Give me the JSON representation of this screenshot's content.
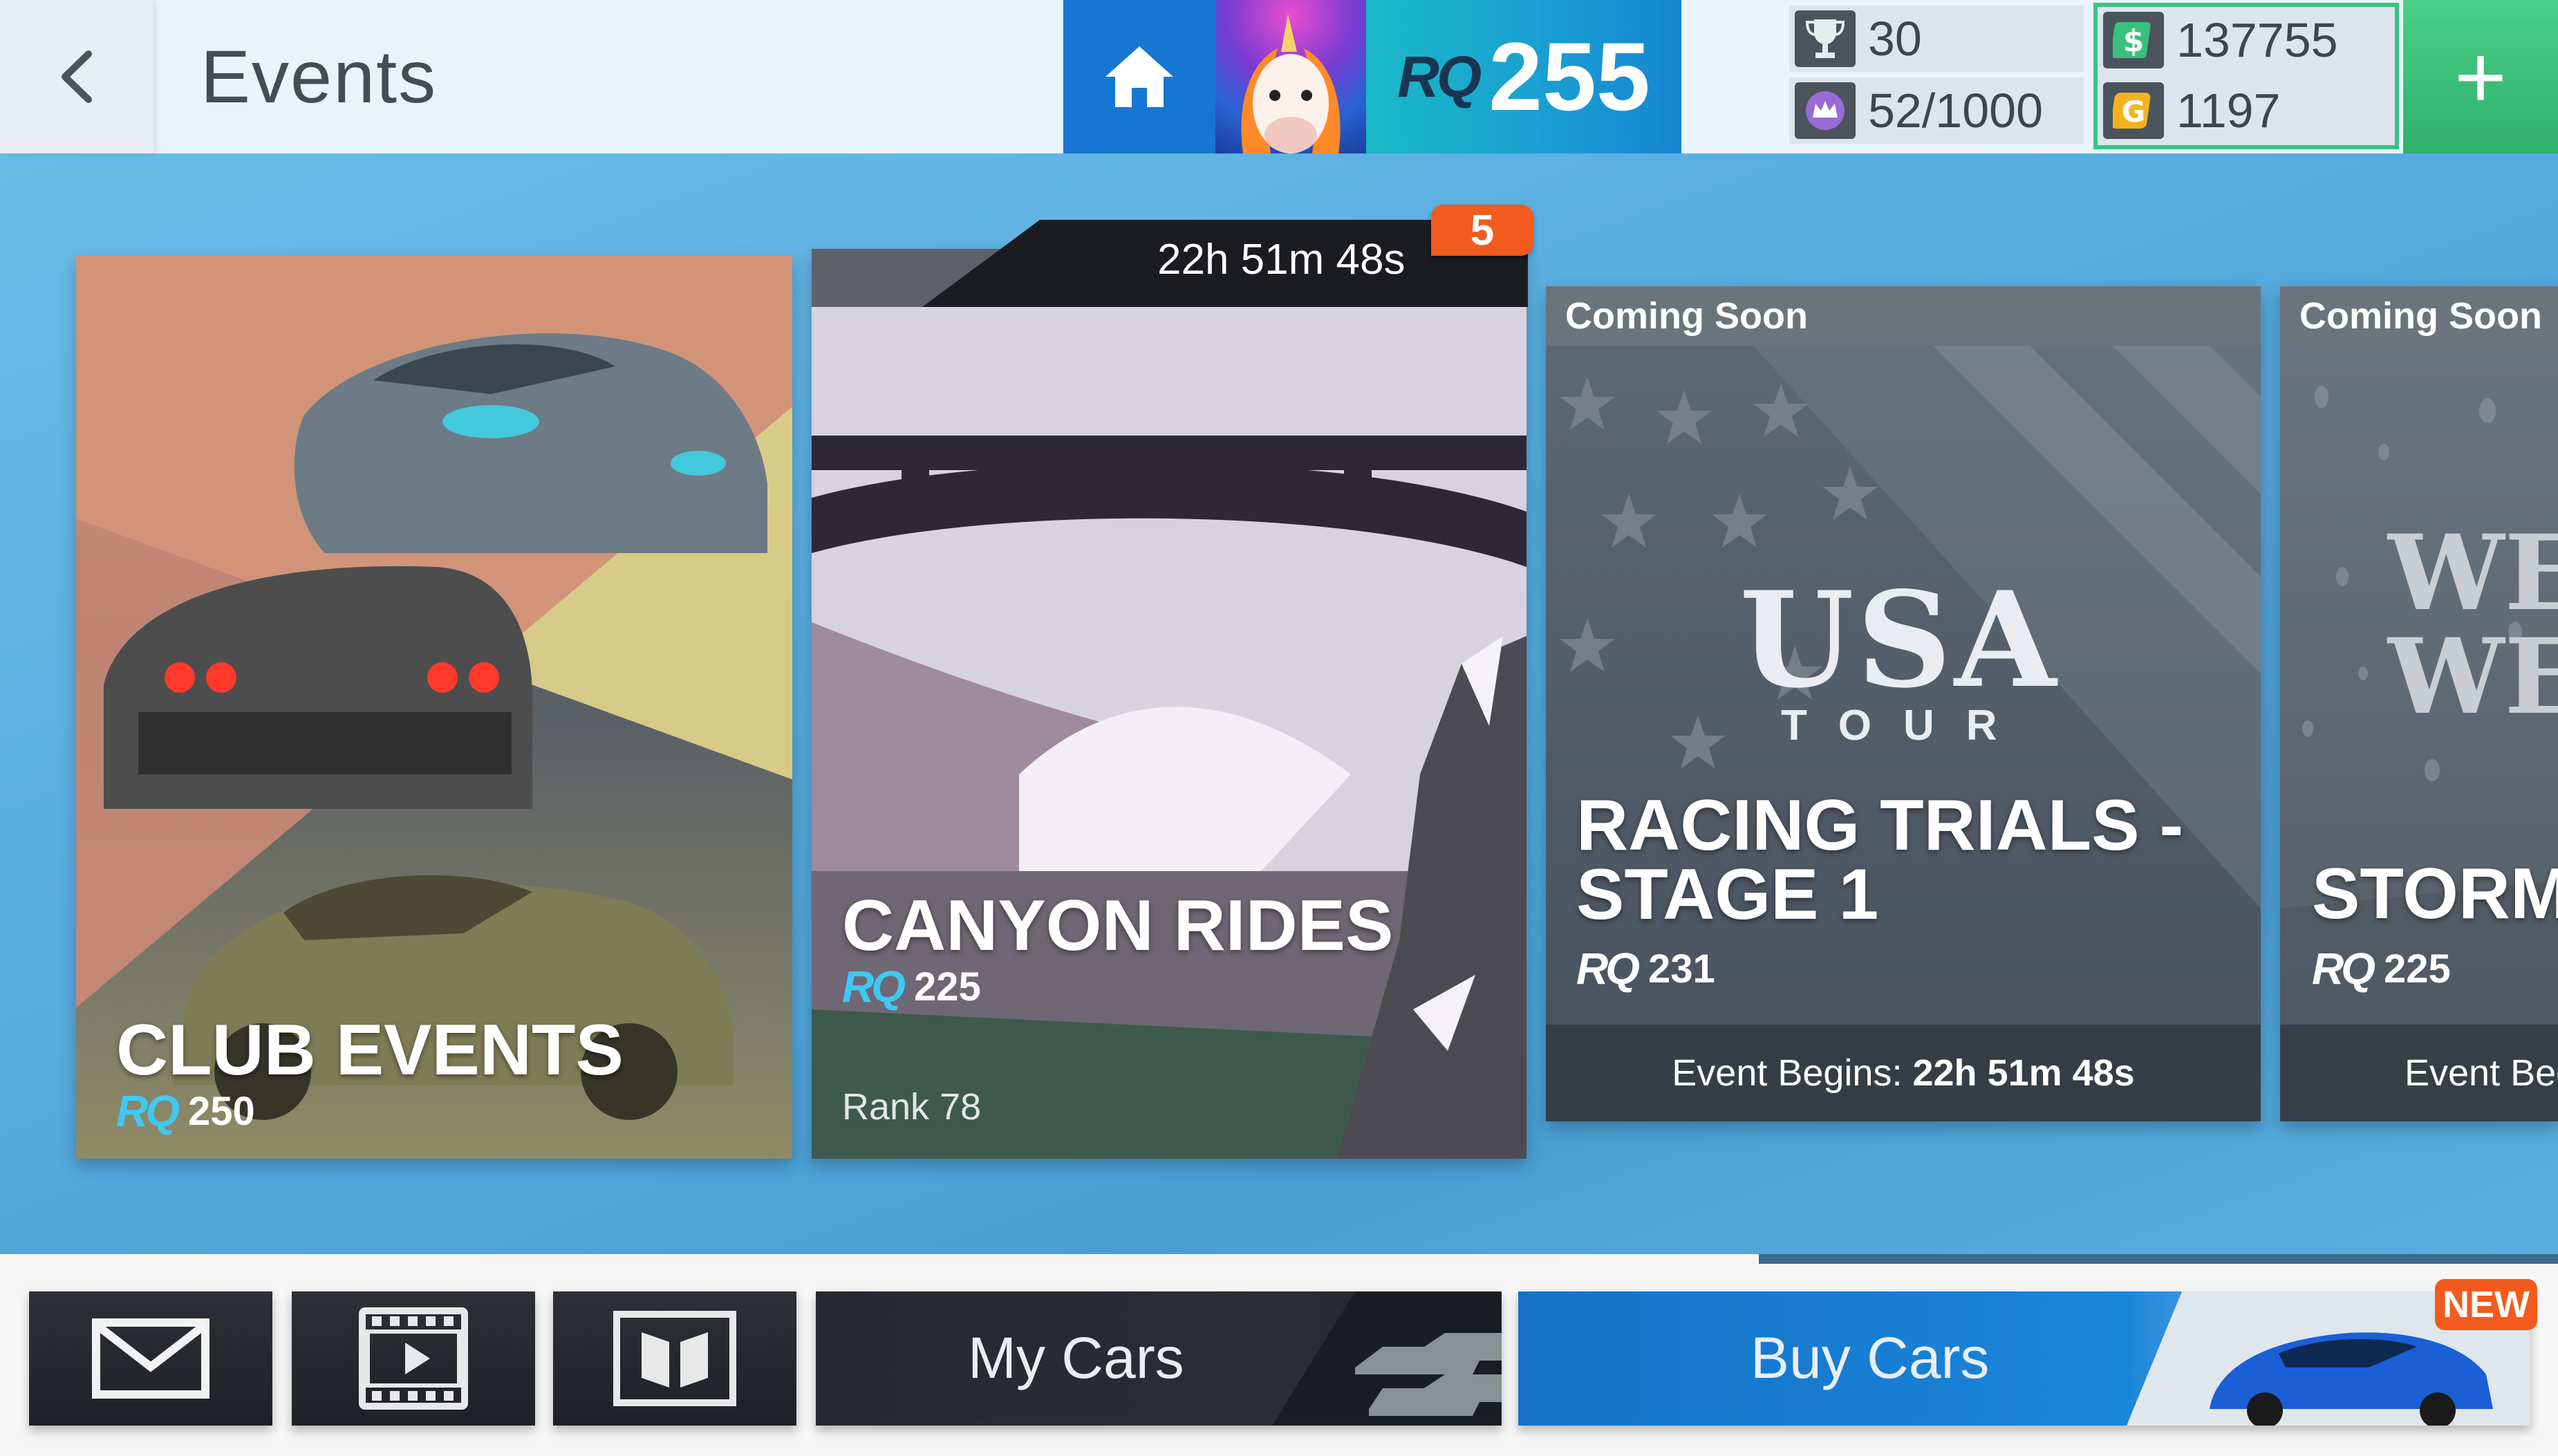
{
  "header": {
    "title": "Events",
    "rq_logo": "RQ",
    "rq_value": "255",
    "trophies": "30",
    "crowns": "52/1000",
    "cash": "137755",
    "gold": "1197",
    "plus": "+"
  },
  "cards": [
    {
      "title": "CLUB EVENTS",
      "rq_logo": "RQ",
      "rq": "250"
    },
    {
      "title": "CANYON RIDES",
      "rq_logo": "RQ",
      "rq": "225",
      "rank": "Rank 78",
      "timer": "22h 51m 48s",
      "badge": "5"
    },
    {
      "status": "Coming Soon",
      "art_line1": "USA",
      "art_line2": "TOUR",
      "title_line1": "RACING TRIALS -",
      "title_line2": "STAGE 1",
      "rq_logo": "RQ",
      "rq": "231",
      "footer_label": "Event Begins:",
      "footer_time": "22h 51m 48s"
    },
    {
      "status": "Coming Soon",
      "art_line1": "WET",
      "art_line2": "WEAT",
      "title": "STORM",
      "rq_logo": "RQ",
      "rq": "225",
      "footer_label": "Event Beg"
    }
  ],
  "bottom_nav": {
    "my_cars": "My Cars",
    "buy_cars": "Buy Cars",
    "new_badge": "NEW"
  },
  "colors": {
    "accent_blue": "#1677d2",
    "badge_orange": "#f25a1e",
    "rq_cyan": "#3fc8f4",
    "currency_green": "#36c488"
  }
}
